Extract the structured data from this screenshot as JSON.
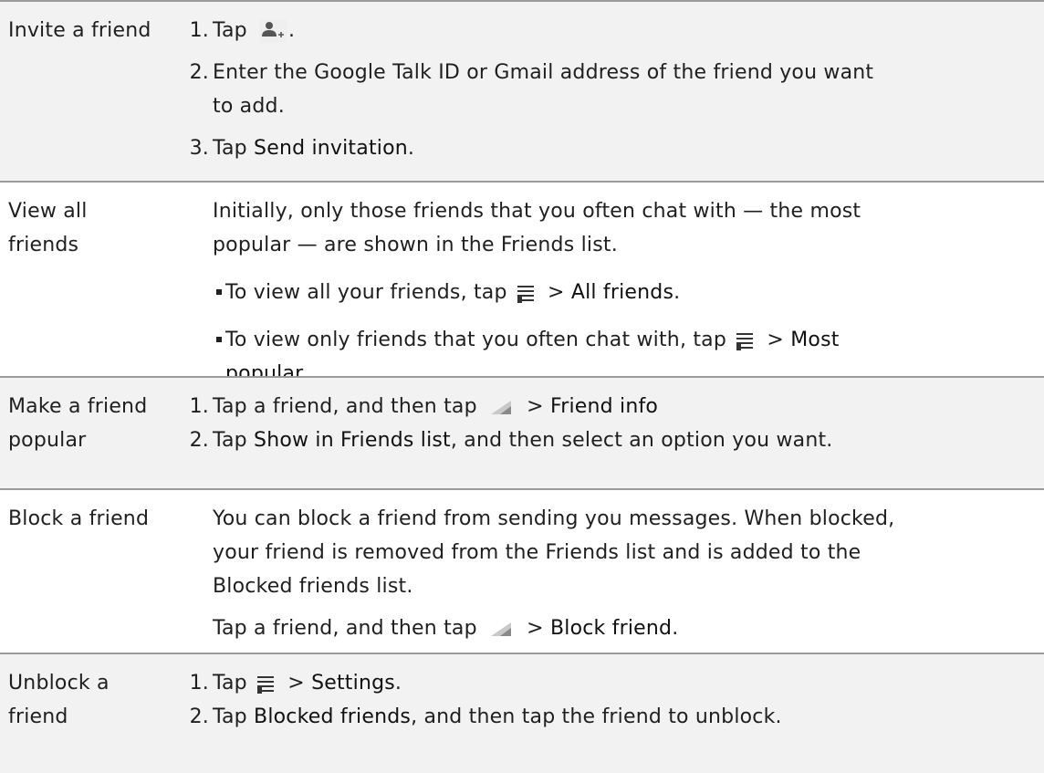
{
  "rows": [
    {
      "label": "Invite a friend",
      "steps": [
        {
          "num": "1.",
          "pre": "Tap ",
          "post": "."
        },
        {
          "num": "2.",
          "text": "Enter the Google Talk ID or Gmail address of the friend you want",
          "cont": "to add."
        },
        {
          "num": "3.",
          "pre": "Tap ",
          "ui": "Send invitation",
          "post": "."
        }
      ]
    },
    {
      "label_1": "View all",
      "label_2": "friends",
      "intro_1": "Initially, only those friends that you often chat with — the most",
      "intro_2": "popular — are shown in the Friends list.",
      "bullets": [
        {
          "pre": "To view all your friends, tap ",
          "mid": " > ",
          "ui": "All friends",
          "post": "."
        },
        {
          "pre": "To view only friends that you often chat with, tap ",
          "mid": " > ",
          "ui": "Most",
          "cont_ui": "popular",
          "post": "."
        }
      ]
    },
    {
      "label_1": "Make a friend",
      "label_2": "popular",
      "steps": [
        {
          "num": "1.",
          "pre": "Tap a friend, and then tap ",
          "mid": " > ",
          "ui": "Friend info"
        },
        {
          "num": "2.",
          "pre": "Tap ",
          "ui": "Show in Friends list",
          "post": ", and then select an option you want."
        }
      ]
    },
    {
      "label": "Block a friend",
      "text_1": "You can block a friend from sending you messages. When blocked,",
      "text_2": "your friend is removed from the Friends list and is added to the",
      "text_3": "Blocked friends list.",
      "action": {
        "pre": "Tap a friend, and then tap ",
        "mid": " > ",
        "ui": "Block friend",
        "post": "."
      }
    },
    {
      "label_1": "Unblock a",
      "label_2": "friend",
      "steps": [
        {
          "num": "1.",
          "pre": "Tap ",
          "mid": " > ",
          "ui": "Settings",
          "post": "."
        },
        {
          "num": "2.",
          "pre": "Tap ",
          "ui": "Blocked friends",
          "post": ", and then tap the friend to unblock."
        }
      ]
    }
  ],
  "icons": {
    "add_friend": "add-friend-icon",
    "menu": "menu-icon",
    "more": "more-wedge-icon"
  }
}
